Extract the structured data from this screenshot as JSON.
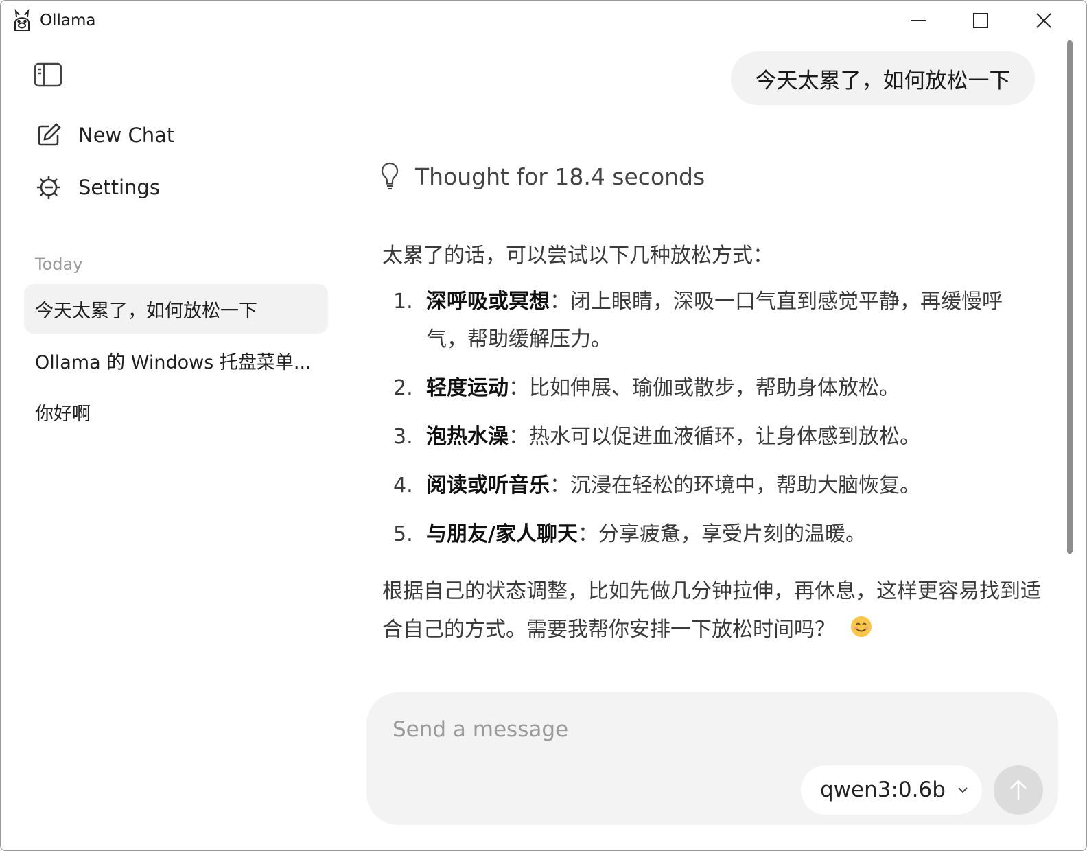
{
  "window": {
    "title": "Ollama"
  },
  "sidebar": {
    "new_chat_label": "New Chat",
    "settings_label": "Settings",
    "section_label": "Today",
    "history": [
      {
        "label": "今天太累了，如何放松一下",
        "active": true
      },
      {
        "label": "Ollama 的 Windows 托盘菜单...",
        "active": false
      },
      {
        "label": "你好啊",
        "active": false
      }
    ]
  },
  "chat": {
    "user_message": "今天太累了，如何放松一下",
    "thought_label": "Thought for 18.4 seconds",
    "answer": {
      "intro": "太累了的话，可以尝试以下几种放松方式：",
      "items": [
        {
          "num": "1.",
          "title": "深呼吸或冥想",
          "text": "：闭上眼睛，深吸一口气直到感觉平静，再缓慢呼气，帮助缓解压力。"
        },
        {
          "num": "2.",
          "title": "轻度运动",
          "text": "：比如伸展、瑜伽或散步，帮助身体放松。"
        },
        {
          "num": "3.",
          "title": "泡热水澡",
          "text": "：热水可以促进血液循环，让身体感到放松。"
        },
        {
          "num": "4.",
          "title": "阅读或听音乐",
          "text": "：沉浸在轻松的环境中，帮助大脑恢复。"
        },
        {
          "num": "5.",
          "title": "与朋友/家人聊天",
          "text": "：分享疲惫，享受片刻的温暖。"
        }
      ],
      "outro": "根据自己的状态调整，比如先做几分钟拉伸，再休息，这样更容易找到适合自己的方式。需要我帮你安排一下放松时间吗？"
    }
  },
  "composer": {
    "placeholder": "Send a message",
    "value": "",
    "model": "qwen3:0.6b"
  },
  "colors": {
    "bubble_bg": "#f2f2f2",
    "composer_bg": "#f3f3f3",
    "send_disabled": "#dcdcdc"
  }
}
